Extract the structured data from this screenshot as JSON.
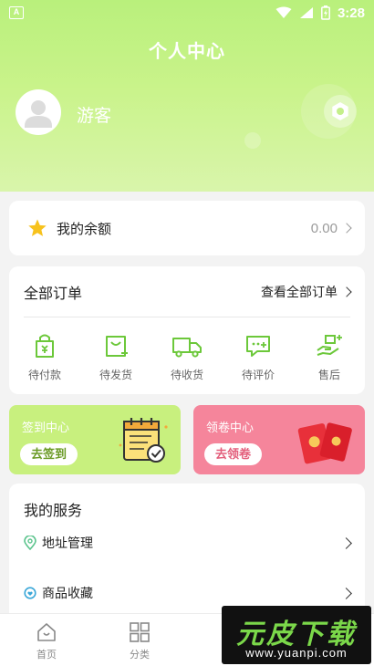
{
  "status_bar": {
    "app_indicator": "A",
    "time": "3:28"
  },
  "header": {
    "title": "个人中心",
    "username": "游客"
  },
  "balance": {
    "label": "我的余额",
    "value": "0.00"
  },
  "orders": {
    "title": "全部订单",
    "view_all": "查看全部订单",
    "items": [
      {
        "label": "待付款",
        "icon": "bag-payment-icon"
      },
      {
        "label": "待发货",
        "icon": "bag-ship-icon"
      },
      {
        "label": "待收货",
        "icon": "truck-icon"
      },
      {
        "label": "待评价",
        "icon": "comment-icon"
      },
      {
        "label": "售后",
        "icon": "after-sale-icon"
      }
    ]
  },
  "promos": {
    "sign_in": {
      "title": "签到中心",
      "button": "去签到",
      "color": "#c8f07e"
    },
    "coupon": {
      "title": "领卷中心",
      "button": "去领卷",
      "color": "#f5859b"
    }
  },
  "services": {
    "title": "我的服务",
    "items": [
      {
        "label": "地址管理",
        "icon": "location-icon"
      },
      {
        "label": "商品收藏",
        "icon": "favorite-icon"
      }
    ]
  },
  "tabbar": {
    "items": [
      {
        "label": "首页",
        "icon": "home-icon"
      },
      {
        "label": "分类",
        "icon": "category-grid-icon"
      }
    ]
  },
  "watermark": {
    "title": "元皮下载",
    "url": "www.yuanpi.com"
  },
  "colors": {
    "accent_green": "#7cd83a",
    "header_green": "#b9f07c",
    "coupon_pink": "#f5859b"
  }
}
